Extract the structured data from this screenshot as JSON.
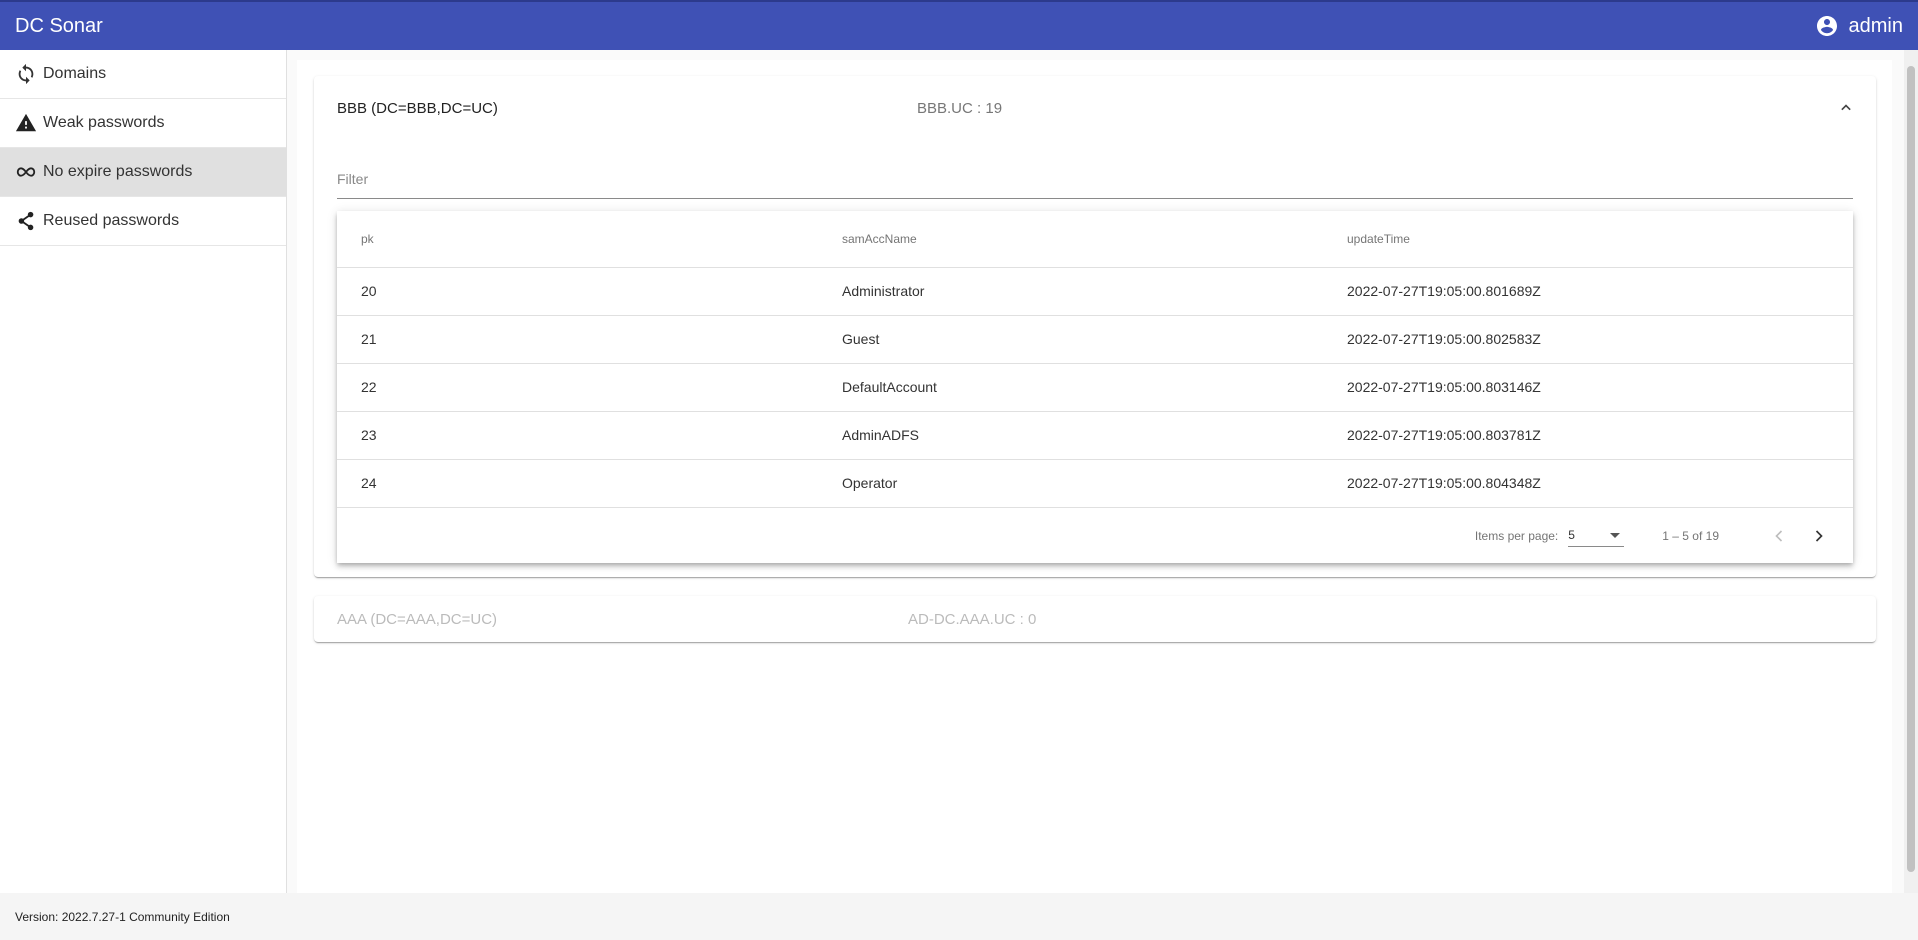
{
  "app": {
    "title": "DC Sonar",
    "user": "admin"
  },
  "sidebar": {
    "items": [
      {
        "label": "Domains",
        "icon": "sync-icon"
      },
      {
        "label": "Weak passwords",
        "icon": "warning-icon"
      },
      {
        "label": "No expire passwords",
        "icon": "infinity-icon",
        "active": true
      },
      {
        "label": "Reused passwords",
        "icon": "share-icon"
      }
    ]
  },
  "panels": [
    {
      "title": "BBB (DC=BBB,DC=UC)",
      "description": "BBB.UC : 19",
      "expanded": true,
      "filter_placeholder": "Filter",
      "table": {
        "columns": [
          "pk",
          "samAccName",
          "updateTime"
        ],
        "rows": [
          [
            "20",
            "Administrator",
            "2022-07-27T19:05:00.801689Z"
          ],
          [
            "21",
            "Guest",
            "2022-07-27T19:05:00.802583Z"
          ],
          [
            "22",
            "DefaultAccount",
            "2022-07-27T19:05:00.803146Z"
          ],
          [
            "23",
            "AdminADFS",
            "2022-07-27T19:05:00.803781Z"
          ],
          [
            "24",
            "Operator",
            "2022-07-27T19:05:00.804348Z"
          ]
        ]
      },
      "paginator": {
        "items_per_page_label": "Items per page:",
        "items_per_page": "5",
        "range": "1 – 5 of 19"
      }
    },
    {
      "title": "AAA (DC=AAA,DC=UC)",
      "description": "AD-DC.AAA.UC : 0",
      "expanded": false
    }
  ],
  "footer": {
    "version": "Version: 2022.7.27-1 Community Edition"
  },
  "colors": {
    "primary": "#3f51b5",
    "active_nav": "#e0e0e0"
  }
}
